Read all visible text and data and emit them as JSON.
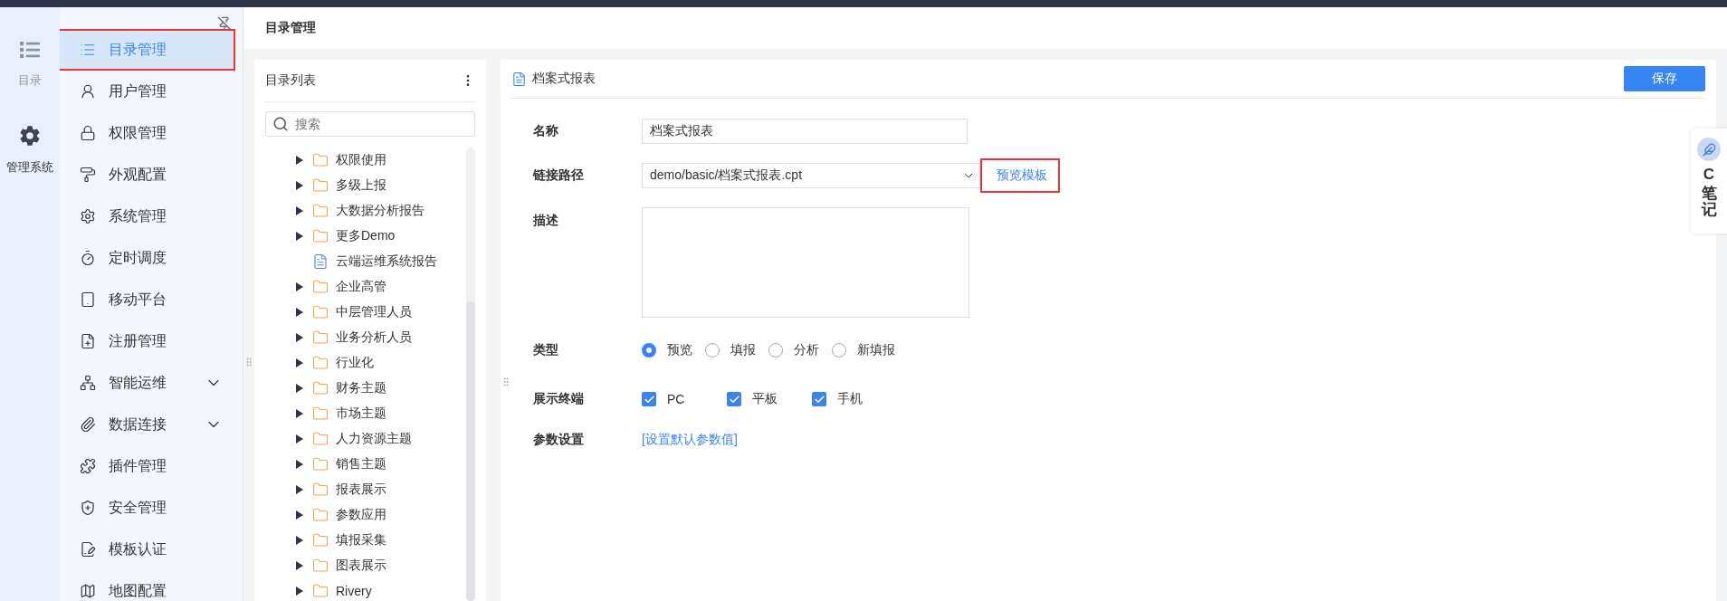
{
  "rail": [
    {
      "label": "目录",
      "selected": false
    },
    {
      "label": "管理系统",
      "selected": true
    }
  ],
  "menu": [
    {
      "label": "目录管理",
      "selected": true,
      "annotated": true,
      "kind": "page"
    },
    {
      "label": "用户管理",
      "selected": false,
      "annotated": false,
      "kind": "page"
    },
    {
      "label": "权限管理",
      "selected": false,
      "annotated": false,
      "kind": "page"
    },
    {
      "label": "外观配置",
      "selected": false,
      "annotated": false,
      "kind": "page"
    },
    {
      "label": "系统管理",
      "selected": false,
      "annotated": false,
      "kind": "page"
    },
    {
      "label": "定时调度",
      "selected": false,
      "annotated": false,
      "kind": "page"
    },
    {
      "label": "移动平台",
      "selected": false,
      "annotated": false,
      "kind": "page"
    },
    {
      "label": "注册管理",
      "selected": false,
      "annotated": false,
      "kind": "page"
    },
    {
      "label": "智能运维",
      "selected": false,
      "annotated": false,
      "kind": "group"
    },
    {
      "label": "数据连接",
      "selected": false,
      "annotated": false,
      "kind": "group"
    },
    {
      "label": "插件管理",
      "selected": false,
      "annotated": false,
      "kind": "page"
    },
    {
      "label": "安全管理",
      "selected": false,
      "annotated": false,
      "kind": "page"
    },
    {
      "label": "模板认证",
      "selected": false,
      "annotated": false,
      "kind": "page"
    },
    {
      "label": "地图配置",
      "selected": false,
      "annotated": false,
      "kind": "page"
    }
  ],
  "header": {
    "title": "目录管理"
  },
  "tree": {
    "title": "目录列表",
    "search": {
      "placeholder": "搜索"
    },
    "items": [
      {
        "label": "权限使用",
        "kind": "folder",
        "expanded": false
      },
      {
        "label": "多级上报",
        "kind": "folder",
        "expanded": false
      },
      {
        "label": "大数据分析报告",
        "kind": "folder",
        "expanded": false
      },
      {
        "label": "更多Demo",
        "kind": "folder",
        "expanded": false
      },
      {
        "label": "云端运维系统报告",
        "kind": "report"
      },
      {
        "label": "企业高管",
        "kind": "folder",
        "expanded": false
      },
      {
        "label": "中层管理人员",
        "kind": "folder",
        "expanded": false
      },
      {
        "label": "业务分析人员",
        "kind": "folder",
        "expanded": false
      },
      {
        "label": "行业化",
        "kind": "folder",
        "expanded": false
      },
      {
        "label": "财务主题",
        "kind": "folder",
        "expanded": false
      },
      {
        "label": "市场主题",
        "kind": "folder",
        "expanded": false
      },
      {
        "label": "人力资源主题",
        "kind": "folder",
        "expanded": false
      },
      {
        "label": "销售主题",
        "kind": "folder",
        "expanded": false
      },
      {
        "label": "报表展示",
        "kind": "folder",
        "expanded": false
      },
      {
        "label": "参数应用",
        "kind": "folder",
        "expanded": false
      },
      {
        "label": "填报采集",
        "kind": "folder",
        "expanded": false
      },
      {
        "label": "图表展示",
        "kind": "folder",
        "expanded": false
      },
      {
        "label": "Rivery",
        "kind": "folder",
        "expanded": false
      }
    ]
  },
  "detail": {
    "title": "档案式报表",
    "save_button": "保存",
    "name": {
      "label": "名称",
      "value": "档案式报表"
    },
    "path": {
      "label": "链接路径",
      "value": "demo/basic/档案式报表.cpt",
      "link": "预览模板",
      "link_annotated": true
    },
    "description": {
      "label": "描述"
    },
    "type": {
      "label": "类型",
      "options": [
        {
          "label": "预览",
          "selected": true
        },
        {
          "label": "填报",
          "selected": false
        },
        {
          "label": "分析",
          "selected": false
        },
        {
          "label": "新填报",
          "selected": false
        }
      ]
    },
    "terminals": {
      "label": "展示终端",
      "options": [
        {
          "label": "PC",
          "checked": true
        },
        {
          "label": "平板",
          "checked": true
        },
        {
          "label": "手机",
          "checked": true
        }
      ]
    },
    "params": {
      "label": "参数设置",
      "link": "[设置默认参数值]"
    }
  },
  "note_tab": {
    "letter": "C",
    "label": "笔记"
  }
}
